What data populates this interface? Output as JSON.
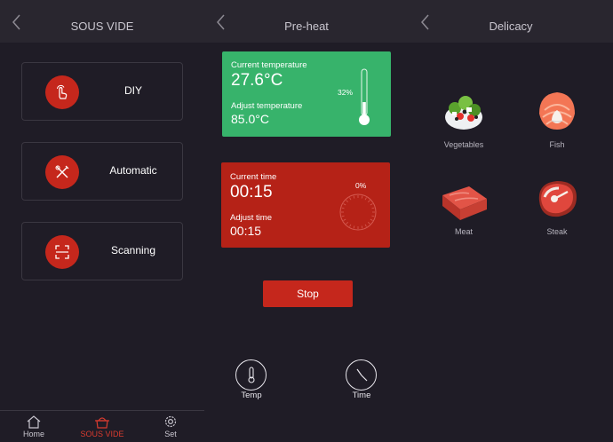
{
  "panel1": {
    "title": "SOUS VIDE",
    "menu": [
      {
        "label": "DIY",
        "icon": "hand-touch-icon"
      },
      {
        "label": "Automatic",
        "icon": "utensils-icon"
      },
      {
        "label": "Scanning",
        "icon": "scan-icon"
      }
    ],
    "tabs": [
      {
        "label": "Home",
        "icon": "home-icon",
        "active": false
      },
      {
        "label": "SOUS VIDE",
        "icon": "pot-icon",
        "active": true
      },
      {
        "label": "Set",
        "icon": "gear-icon",
        "active": false
      }
    ]
  },
  "panel2": {
    "title": "Pre-heat",
    "temperature": {
      "current_label": "Current temperature",
      "current_value": "27.6°C",
      "adjust_label": "Adjust temperature",
      "adjust_value": "85.0°C",
      "progress_label": "32%",
      "progress": 0.32
    },
    "time": {
      "current_label": "Current time",
      "current_value": "00:15",
      "adjust_label": "Adjust time",
      "adjust_value": "00:15",
      "progress_label": "0%",
      "progress": 0
    },
    "stop_label": "Stop",
    "controls": [
      {
        "label": "Temp",
        "icon": "thermometer-icon"
      },
      {
        "label": "Time",
        "icon": "clock-icon"
      }
    ]
  },
  "panel3": {
    "title": "Delicacy",
    "items": [
      {
        "label": "Vegetables",
        "icon": "salad-icon"
      },
      {
        "label": "Fish",
        "icon": "salmon-icon"
      },
      {
        "label": "Meat",
        "icon": "meat-icon"
      },
      {
        "label": "Steak",
        "icon": "steak-icon"
      }
    ]
  },
  "colors": {
    "background": "#1f1c26",
    "header": "#29262f",
    "accent_red": "#c5271c",
    "green": "#37b36b"
  }
}
